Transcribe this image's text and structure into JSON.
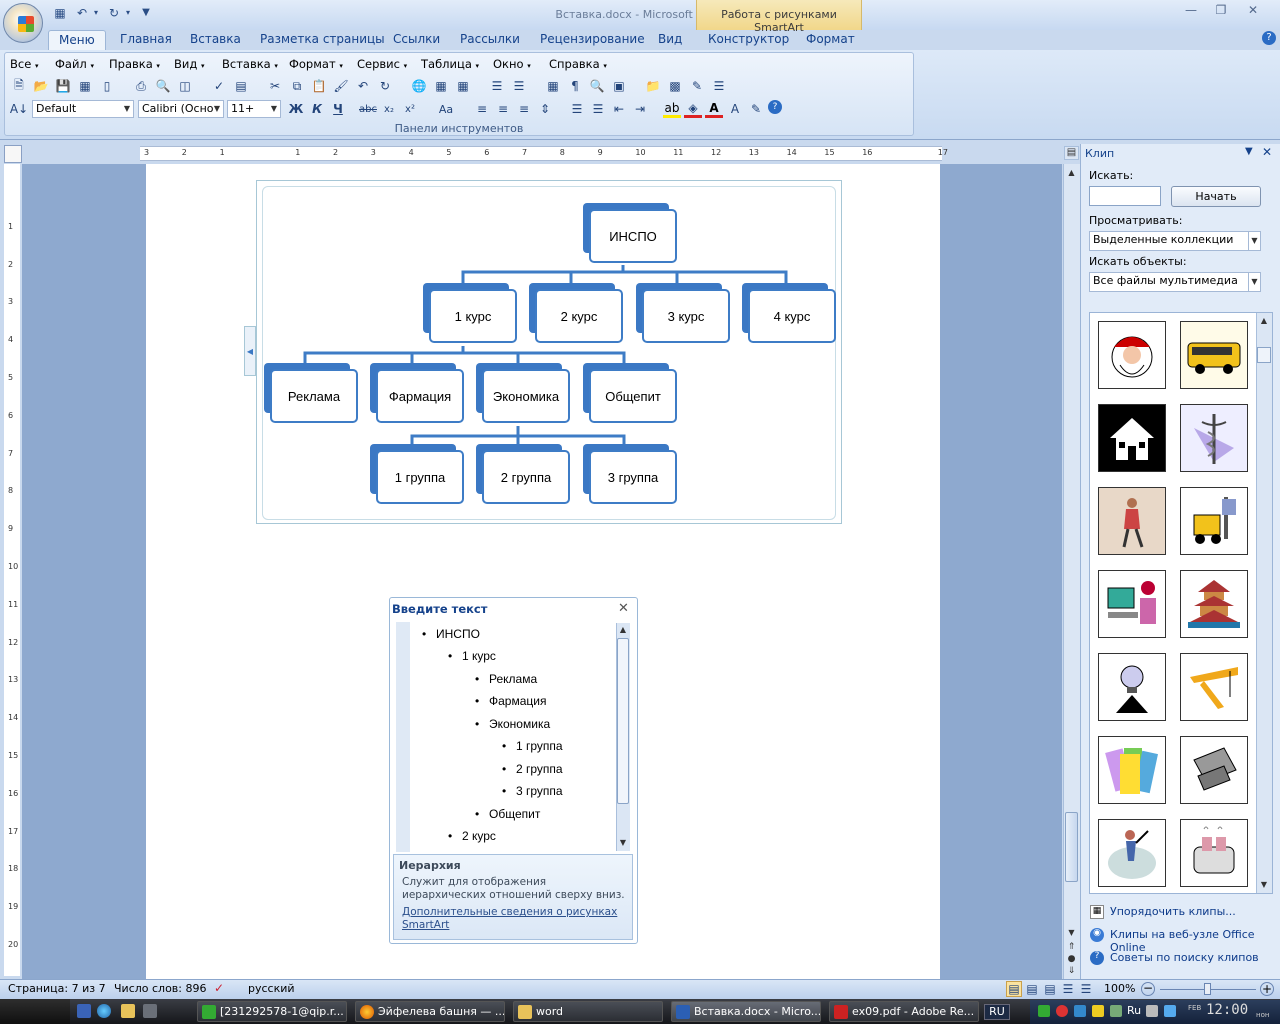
{
  "window": {
    "title": "Вставка.docx - Microsoft Word",
    "context_tab": "Работа с рисунками SmartArt"
  },
  "ribbon_tabs": [
    "Меню",
    "Главная",
    "Вставка",
    "Разметка страницы",
    "Ссылки",
    "Рассылки",
    "Рецензирование",
    "Вид",
    "Конструктор",
    "Формат"
  ],
  "classic_menu": [
    "Все",
    "Файл",
    "Правка",
    "Вид",
    "Вставка",
    "Формат",
    "Сервис",
    "Таблица",
    "Окно",
    "Справка"
  ],
  "toolbar": {
    "style": "Default",
    "font": "Calibri (Осно",
    "size": "11+",
    "group_label": "Панели инструментов",
    "bold": "Ж",
    "italic": "К",
    "underline": "Ч",
    "strike": "abc",
    "sub": "x₂",
    "sup": "x²",
    "case": "Aa"
  },
  "smartart": {
    "root": "ИНСПО",
    "courses": [
      "1 курс",
      "2 курс",
      "3 курс",
      "4 курс"
    ],
    "faculties": [
      "Реклама",
      "Фармация",
      "Экономика",
      "Общепит"
    ],
    "groups": [
      "1 группа",
      "2 группа",
      "3 группа"
    ]
  },
  "text_pane": {
    "title": "Введите текст",
    "items": [
      "ИНСПО",
      "1 курс",
      "Реклама",
      "Фармация",
      "Экономика",
      "1 группа",
      "2 группа",
      "3 группа",
      "Общепит",
      "2 курс"
    ],
    "footer_title": "Иерархия",
    "footer_desc": "Служит для отображения иерархических отношений сверху вниз.",
    "footer_link": "Дополнительные сведения о рисунках SmartArt"
  },
  "clip_panel": {
    "title": "Клип",
    "search_label": "Искать:",
    "search_value": "",
    "start_button": "Начать",
    "browse_label": "Просматривать:",
    "browse_value": "Выделенные коллекции",
    "type_label": "Искать объекты:",
    "type_value": "Все файлы мультимедиа",
    "thumbnails": [
      "santa-clipart",
      "school-bus-clipart",
      "house-clipart",
      "caduceus-clipart",
      "businesswoman-clipart",
      "forklift-clipart",
      "computer-user-clipart",
      "pagoda-clipart",
      "lightbulb-idea-clipart",
      "crane-clipart",
      "papers-clipart",
      "cash-register-clipart",
      "tennis-player-clipart",
      "toaster-clipart"
    ],
    "links": [
      "Упорядочить клипы...",
      "Клипы на веб-узле Office Online",
      "Советы по поиску клипов"
    ]
  },
  "statusbar": {
    "page": "Страница: 7 из 7",
    "words": "Число слов: 896",
    "language": "русский",
    "zoom": "100%"
  },
  "taskbar": {
    "tasks": [
      "[231292578-1@qip.r...",
      "Эйфелева башня — ...",
      "word",
      "Вставка.docx - Micro...",
      "ex09.pdf - Adobe Re..."
    ],
    "lang": "RU",
    "tray_lang": "Ru",
    "clock": "12:00",
    "date_small": "FEB",
    "day": "нон"
  },
  "colors": {
    "node_border": "#3e7cc6",
    "node_shadow": "#3b78c4",
    "ribbon_text": "#15428b"
  }
}
